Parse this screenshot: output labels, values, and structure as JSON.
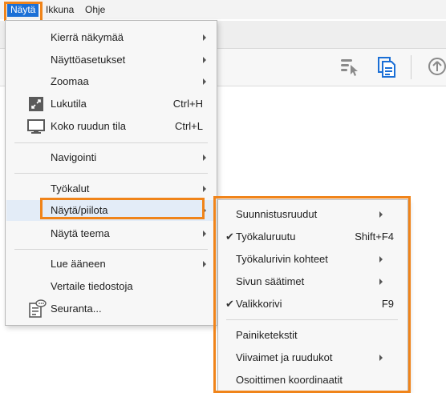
{
  "menubar": {
    "items": [
      "Näytä",
      "Ikkuna",
      "Ohje"
    ]
  },
  "menu": {
    "items": [
      {
        "label": "Kierrä näkymää",
        "submenu": true
      },
      {
        "label": "Näyttöasetukset",
        "submenu": true
      },
      {
        "label": "Zoomaa",
        "submenu": true
      },
      {
        "label": "Lukutila",
        "shortcut": "Ctrl+H",
        "icon": "read-mode-icon"
      },
      {
        "label": "Koko ruudun tila",
        "shortcut": "Ctrl+L",
        "icon": "full-screen-icon"
      },
      {
        "label": "Navigointi",
        "submenu": true
      },
      {
        "label": "Työkalut",
        "submenu": true
      },
      {
        "label": "Näytä/piilota",
        "submenu": true,
        "highlighted": true
      },
      {
        "label": "Näytä teema",
        "submenu": true
      },
      {
        "label": "Lue ääneen",
        "submenu": true
      },
      {
        "label": "Vertaile tiedostoja"
      },
      {
        "label": "Seuranta...",
        "icon": "tracker-icon"
      }
    ]
  },
  "submenu": {
    "items": [
      {
        "label": "Suunnistusruudut",
        "submenu": true
      },
      {
        "label": "Työkaluruutu",
        "shortcut": "Shift+F4",
        "checked": true
      },
      {
        "label": "Työkalurivin kohteet",
        "submenu": true
      },
      {
        "label": "Sivun säätimet",
        "submenu": true
      },
      {
        "label": "Valikkorivi",
        "shortcut": "F9",
        "checked": true
      },
      {
        "label": "Painiketekstit"
      },
      {
        "label": "Viivaimet ja ruudukot",
        "submenu": true
      },
      {
        "label": "Osoittimen koordinaatit"
      }
    ],
    "check_glyph": "✔"
  },
  "colors": {
    "accent_blue": "#1a6fd6",
    "highlight_orange": "#f0841a",
    "menu_bg": "#f7f7f7",
    "hover_bg": "#e3ecf7"
  }
}
